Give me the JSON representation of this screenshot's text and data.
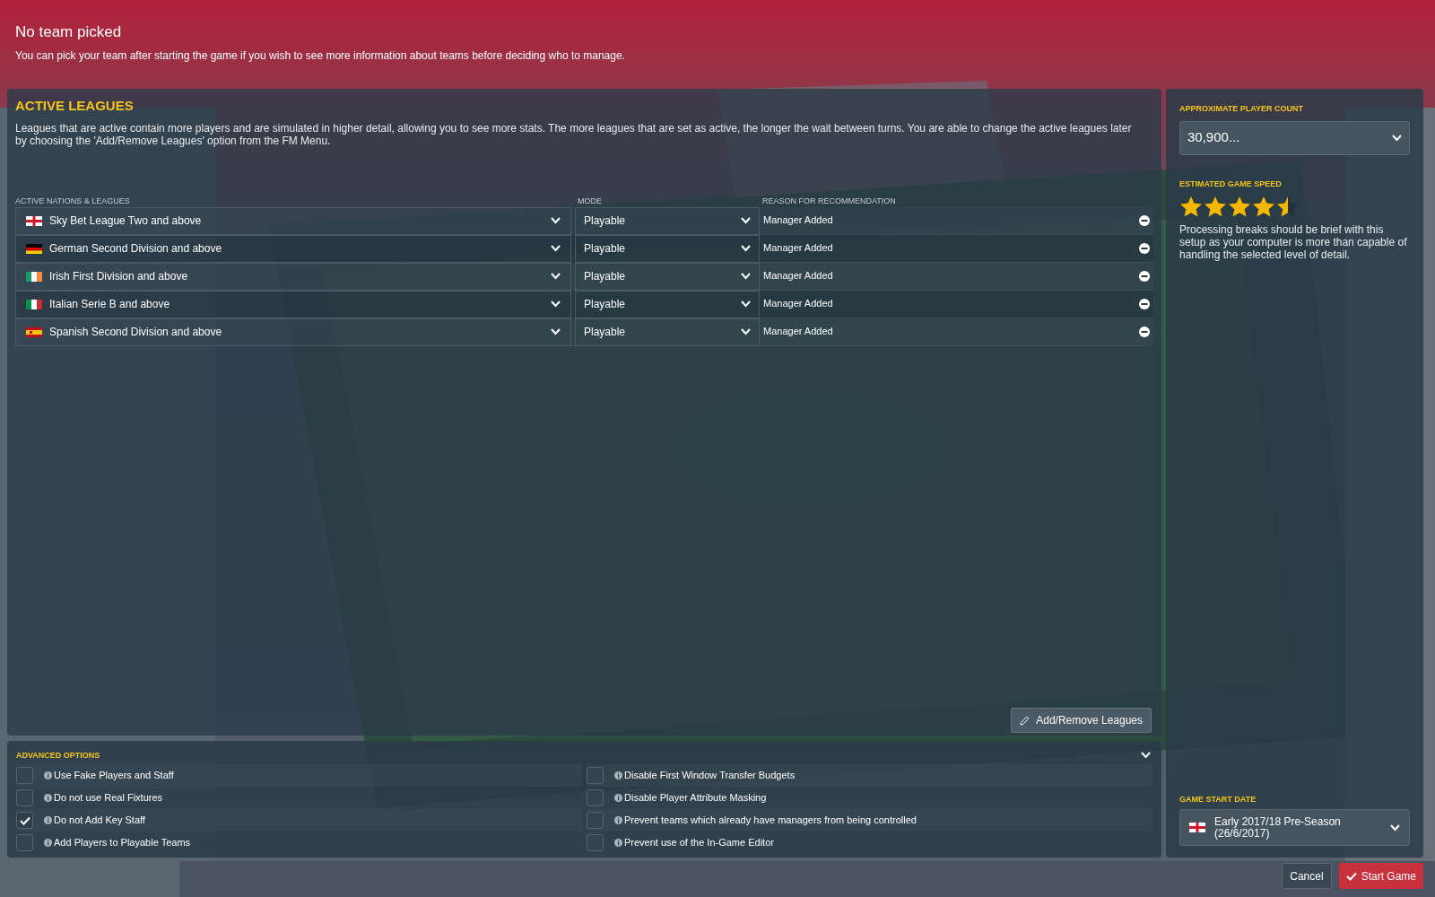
{
  "header": {
    "title": "No team picked",
    "subtitle": "You can pick your team after starting the game if you wish to see more information about teams before deciding who to manage."
  },
  "active_leagues": {
    "title": "ACTIVE LEAGUES",
    "description": "Leagues that are active contain more players and are simulated in higher detail, allowing you to see more stats. The more leagues that are set as active, the longer the wait between turns. You are able to change the active leagues later by choosing the 'Add/Remove Leagues' option from the FM Menu.",
    "columns": [
      "ACTIVE NATIONS & LEAGUES",
      "MODE",
      "REASON FOR RECOMMENDATION"
    ],
    "rows": [
      {
        "kind": "england",
        "league": "Sky Bet League Two and above",
        "mode": "Playable",
        "reason": "Manager Added"
      },
      {
        "kind": "germany",
        "league": "German Second Division and above",
        "mode": "Playable",
        "reason": "Manager Added"
      },
      {
        "kind": "ireland",
        "league": "Irish First Division and above",
        "mode": "Playable",
        "reason": "Manager Added"
      },
      {
        "kind": "italy",
        "league": "Italian Serie B and above",
        "mode": "Playable",
        "reason": "Manager Added"
      },
      {
        "kind": "spain",
        "league": "Spanish Second Division and above",
        "mode": "Playable",
        "reason": "Manager Added"
      }
    ],
    "add_remove_button": "Add/Remove Leagues"
  },
  "advanced_options": {
    "title": "ADVANCED OPTIONS",
    "options": [
      {
        "label": "Use Fake Players and Staff",
        "checked": false
      },
      {
        "label": "Disable First Window Transfer Budgets",
        "checked": false
      },
      {
        "label": "Do not use Real Fixtures",
        "checked": false
      },
      {
        "label": "Disable Player Attribute Masking",
        "checked": false
      },
      {
        "label": "Do not Add Key Staff",
        "checked": true
      },
      {
        "label": "Prevent teams which already have managers from being controlled",
        "checked": false
      },
      {
        "label": "Add Players to Playable Teams",
        "checked": false
      },
      {
        "label": "Prevent use of the In-Game Editor",
        "checked": false
      }
    ]
  },
  "sidebar": {
    "player_count_label": "APPROXIMATE PLAYER COUNT",
    "player_count": "30,900...",
    "speed_label": "ESTIMATED GAME SPEED",
    "stars": 4.5,
    "speed_note": "Processing breaks should be brief with this setup as your computer is more than capable of handling the selected level of detail.",
    "start_date_label": "GAME START DATE",
    "start_date": {
      "kind": "england",
      "text": "Early 2017/18 Pre-Season (26/6/2017)"
    }
  },
  "buttons": {
    "cancel": "Cancel",
    "start": "Start Game"
  }
}
